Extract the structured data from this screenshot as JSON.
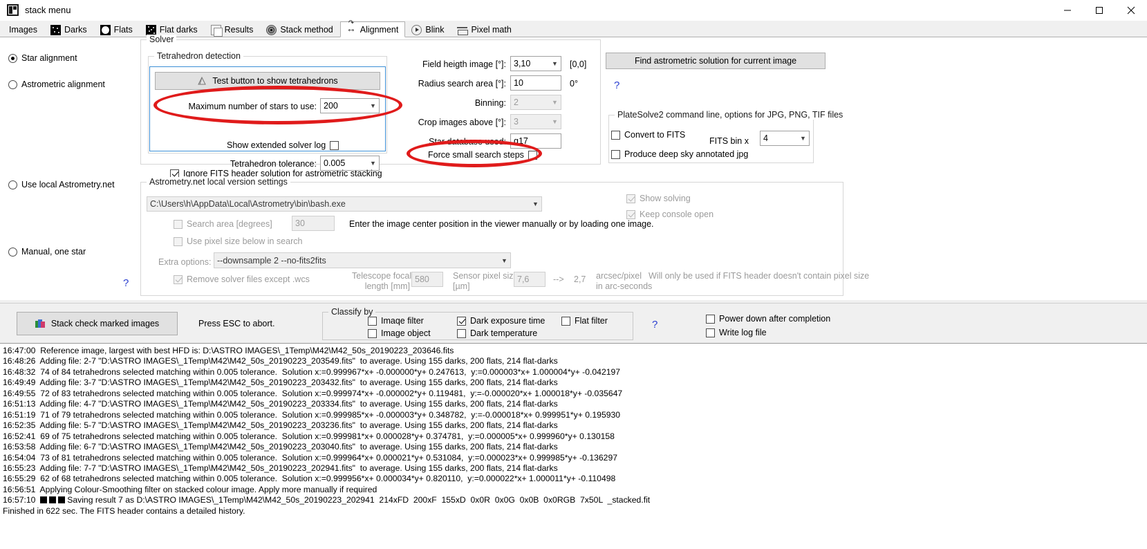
{
  "window": {
    "title": "stack menu",
    "icon": "app-icon",
    "minimize": "minimize-icon",
    "maximize": "maximize-icon",
    "close": "close-icon"
  },
  "tabs": [
    {
      "label": "Images",
      "icon": "",
      "active": false
    },
    {
      "label": "Darks",
      "icon": "darks-icon",
      "active": false
    },
    {
      "label": "Flats",
      "icon": "flats-icon",
      "active": false
    },
    {
      "label": "Flat darks",
      "icon": "flat-darks-icon",
      "active": false
    },
    {
      "label": "Results",
      "icon": "results-icon",
      "active": false
    },
    {
      "label": "Stack method",
      "icon": "stack-method-icon",
      "active": false
    },
    {
      "label": "Alignment",
      "icon": "alignment-icon",
      "active": true
    },
    {
      "label": "Blink",
      "icon": "blink-icon",
      "active": false
    },
    {
      "label": "Pixel math",
      "icon": "pixel-math-icon",
      "active": false
    }
  ],
  "alignment_modes": [
    {
      "label": "Star alignment",
      "checked": true
    },
    {
      "label": "Astrometric alignment",
      "checked": false
    },
    {
      "label": "Use local Astrometry.net",
      "checked": false
    },
    {
      "label": "Manual, one star",
      "checked": false
    }
  ],
  "solver": {
    "group_title": "Solver",
    "tetrahedron": {
      "group_title": "Tetrahedron detection",
      "test_button": "Test button to show tetrahedrons",
      "max_stars_label": "Maximum number of stars to use:",
      "max_stars_value": "200",
      "tolerance_label": "Tetrahedron tolerance:",
      "tolerance_value": "0.005",
      "extended_log_label": "Show extended solver log",
      "extended_log_checked": false
    },
    "field_height_label": "Field heigth image [°]:",
    "field_height_value": "3,10",
    "field_height_note": "[0,0]",
    "radius_label": "Radius search area  [°]:",
    "radius_value": "10",
    "radius_note": "0°",
    "binning_label": "Binning:",
    "binning_value": "2",
    "crop_label": "Crop images above [°]:",
    "crop_value": "3",
    "star_db_label": "Star database used:",
    "star_db_value": "g17",
    "force_small_steps_label": "Force small search steps",
    "force_small_steps_checked": false,
    "find_solution_button": "Find astrometric solution for current image",
    "help_mark": "?",
    "platesolve": {
      "group_title": "PlateSolve2 command line, options for JPG, PNG, TIF files",
      "convert_label": "Convert to FITS",
      "convert_checked": false,
      "fits_bin_label": "FITS bin x",
      "fits_bin_value": "4",
      "annotated_label": "Produce deep sky annotated jpg",
      "annotated_checked": false
    }
  },
  "ignore_fits": {
    "label": "Ignore FITS header solution for astrometric stacking",
    "checked": true
  },
  "astrometry": {
    "group_title": "Astrometry.net local version settings",
    "path_value": "C:\\Users\\h\\AppData\\Local\\Astrometry\\bin\\bash.exe",
    "search_area_label": "Search area [degrees]",
    "search_area_checked": false,
    "search_area_value": "30",
    "hint": "Enter the image center position in the viewer manually or by loading one image.",
    "pixel_size_label": "Use pixel size below in search",
    "pixel_size_checked": false,
    "extra_options_label": "Extra options:",
    "extra_options_value": "--downsample 2 --no-fits2fits",
    "remove_solver_label": "Remove solver files except .wcs",
    "remove_solver_checked": true,
    "focal_label_1": "Telescope focal",
    "focal_label_2": "length [mm]",
    "focal_value": "580",
    "sensor_label_1": "Sensor pixel size",
    "sensor_label_2": "[µm]",
    "sensor_value": "7,6",
    "arrow": "-->",
    "arcsec_value": "2,7",
    "arcsec_unit": "arcsec/pixel",
    "arcsec_note_1": "Will only be used if FITS header doesn't contain pixel size",
    "arcsec_note_2": "in arc-seconds",
    "show_solving_label": "Show solving",
    "show_solving_checked": true,
    "keep_console_label": "Keep console open",
    "keep_console_checked": true,
    "help_mark": "?"
  },
  "bottom": {
    "stack_button": "Stack check marked images",
    "abort_text": "Press ESC to abort.",
    "classify_group": "Classify by",
    "classify": [
      {
        "label": "Imaqe filter",
        "checked": false
      },
      {
        "label": "Image object",
        "checked": false
      },
      {
        "label": "Dark exposure time",
        "checked": true
      },
      {
        "label": "Dark temperature",
        "checked": false
      },
      {
        "label": "Flat filter",
        "checked": false
      }
    ],
    "help_mark": "?",
    "power_down_label": "Power down after completion",
    "power_down_checked": false,
    "write_log_label": "Write log file",
    "write_log_checked": false
  },
  "log": {
    "lines": [
      "16:47:00  Reference image, largest with best HFD is: D:\\ASTRO IMAGES\\_1Temp\\M42\\M42_50s_20190223_203646.fits",
      "16:48:26  Adding file: 2-7 \"D:\\ASTRO IMAGES\\_1Temp\\M42\\M42_50s_20190223_203549.fits\"  to average. Using 155 darks, 200 flats, 214 flat-darks",
      "16:48:32  74 of 84 tetrahedrons selected matching within 0.005 tolerance.  Solution x:=0.999967*x+ -0.000000*y+ 0.247613,  y:=0.000003*x+ 1.000004*y+ -0.042197",
      "16:49:49  Adding file: 3-7 \"D:\\ASTRO IMAGES\\_1Temp\\M42\\M42_50s_20190223_203432.fits\"  to average. Using 155 darks, 200 flats, 214 flat-darks",
      "16:49:55  72 of 83 tetrahedrons selected matching within 0.005 tolerance.  Solution x:=0.999974*x+ -0.000002*y+ 0.119481,  y:=-0.000020*x+ 1.000018*y+ -0.035647",
      "16:51:13  Adding file: 4-7 \"D:\\ASTRO IMAGES\\_1Temp\\M42\\M42_50s_20190223_203334.fits\"  to average. Using 155 darks, 200 flats, 214 flat-darks",
      "16:51:19  71 of 79 tetrahedrons selected matching within 0.005 tolerance.  Solution x:=0.999985*x+ -0.000003*y+ 0.348782,  y:=-0.000018*x+ 0.999951*y+ 0.195930",
      "16:52:35  Adding file: 5-7 \"D:\\ASTRO IMAGES\\_1Temp\\M42\\M42_50s_20190223_203236.fits\"  to average. Using 155 darks, 200 flats, 214 flat-darks",
      "16:52:41  69 of 75 tetrahedrons selected matching within 0.005 tolerance.  Solution x:=0.999981*x+ 0.000028*y+ 0.374781,  y:=0.000005*x+ 0.999960*y+ 0.130158",
      "16:53:58  Adding file: 6-7 \"D:\\ASTRO IMAGES\\_1Temp\\M42\\M42_50s_20190223_203040.fits\"  to average. Using 155 darks, 200 flats, 214 flat-darks",
      "16:54:04  73 of 81 tetrahedrons selected matching within 0.005 tolerance.  Solution x:=0.999964*x+ 0.000021*y+ 0.531084,  y:=0.000023*x+ 0.999985*y+ -0.136297",
      "16:55:23  Adding file: 7-7 \"D:\\ASTRO IMAGES\\_1Temp\\M42\\M42_50s_20190223_202941.fits\"  to average. Using 155 darks, 200 flats, 214 flat-darks",
      "16:55:29  62 of 68 tetrahedrons selected matching within 0.005 tolerance.  Solution x:=0.999956*x+ 0.000034*y+ 0.820110,  y:=0.000022*x+ 1.000011*y+ -0.110498",
      "16:56:51  Applying Colour-Smoothing filter on stacked colour image. Apply more manually if required"
    ],
    "saving_prefix": "16:57:10  ",
    "saving_line": "Saving result 7 as D:\\ASTRO IMAGES\\_1Temp\\M42\\M42_50s_20190223_202941  214xFD  200xF  155xD  0x0R  0x0G  0x0B  0x0RGB  7x50L  _stacked.fit",
    "final_line": "Finished in 622 sec. The FITS header contains a detailed history."
  },
  "colors": {
    "annotation_red": "#e01b1b",
    "group_blue": "#3d8fd6",
    "link_blue": "#2a3fd0"
  }
}
